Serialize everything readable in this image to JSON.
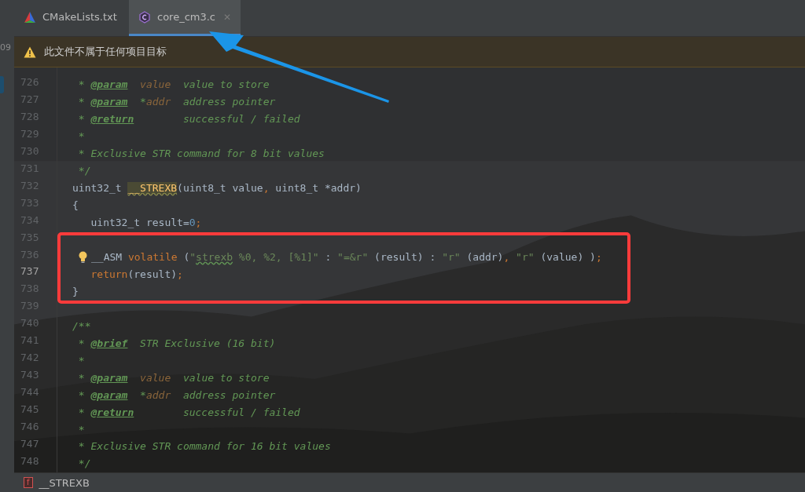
{
  "side_strip": {
    "text": "09"
  },
  "tabs": [
    {
      "label": "CMakeLists.txt",
      "kind": "cmake",
      "selected": false
    },
    {
      "label": "core_cm3.c",
      "kind": "c",
      "selected": true,
      "close": "✕"
    }
  ],
  "notice": {
    "text": "此文件不属于任何项目目标"
  },
  "lines": [
    {
      "number": "726",
      "current": false,
      "tokens": [
        {
          "kind": "comment",
          "text": " * "
        },
        {
          "kind": "tag",
          "text": "@param"
        },
        {
          "kind": "param",
          "text": "  value"
        },
        {
          "kind": "comment",
          "text": "  value to store"
        }
      ]
    },
    {
      "number": "727",
      "current": false,
      "tokens": [
        {
          "kind": "comment",
          "text": " * "
        },
        {
          "kind": "tag",
          "text": "@param"
        },
        {
          "kind": "comment",
          "text": "  *"
        },
        {
          "kind": "param",
          "text": "addr"
        },
        {
          "kind": "comment",
          "text": "  address pointer"
        }
      ]
    },
    {
      "number": "728",
      "current": false,
      "tokens": [
        {
          "kind": "comment",
          "text": " * "
        },
        {
          "kind": "tag",
          "text": "@return"
        },
        {
          "kind": "comment",
          "text": "        successful / failed"
        }
      ]
    },
    {
      "number": "729",
      "current": false,
      "tokens": [
        {
          "kind": "comment",
          "text": " *"
        }
      ]
    },
    {
      "number": "730",
      "current": false,
      "tokens": [
        {
          "kind": "comment",
          "text": " * Exclusive STR command for 8 bit values"
        }
      ]
    },
    {
      "number": "731",
      "current": false,
      "tokens": [
        {
          "kind": "comment",
          "text": " */"
        }
      ]
    },
    {
      "number": "732",
      "current": false,
      "tokens": [
        {
          "kind": "plain",
          "text": "uint32_t "
        },
        {
          "kind": "usage",
          "text": "__STREXB"
        },
        {
          "kind": "plain",
          "text": "(uint8_t value"
        },
        {
          "kind": "punct",
          "text": ","
        },
        {
          "kind": "plain",
          "text": " uint8_t *addr)"
        }
      ]
    },
    {
      "number": "733",
      "current": false,
      "tokens": [
        {
          "kind": "plain",
          "text": "{"
        }
      ]
    },
    {
      "number": "734",
      "current": false,
      "tokens": [
        {
          "kind": "plain",
          "text": "   uint32_t result="
        },
        {
          "kind": "number",
          "text": "0"
        },
        {
          "kind": "punct",
          "text": ";"
        }
      ]
    },
    {
      "number": "735",
      "current": false
    },
    {
      "number": "736",
      "current": false,
      "bulb": true,
      "tokens": [
        {
          "kind": "plain",
          "text": "__ASM "
        },
        {
          "kind": "keyword",
          "text": "volatile"
        },
        {
          "kind": "plain",
          "text": " ("
        },
        {
          "kind": "string",
          "text": "\""
        },
        {
          "kind": "typo",
          "text": "strexb"
        },
        {
          "kind": "string",
          "text": " %0, %2, [%1]\""
        },
        {
          "kind": "plain",
          "text": " : "
        },
        {
          "kind": "string",
          "text": "\"=&r\""
        },
        {
          "kind": "plain",
          "text": " (result) : "
        },
        {
          "kind": "string",
          "text": "\"r\""
        },
        {
          "kind": "plain",
          "text": " (addr)"
        },
        {
          "kind": "punct",
          "text": ","
        },
        {
          "kind": "string",
          "text": " \"r\""
        },
        {
          "kind": "plain",
          "text": " (value) )"
        },
        {
          "kind": "punct",
          "text": ";"
        }
      ]
    },
    {
      "number": "737",
      "current": true,
      "tokens": [
        {
          "kind": "keyword",
          "text": "   return"
        },
        {
          "kind": "plain",
          "text": "(result)"
        },
        {
          "kind": "punct",
          "text": ";"
        }
      ]
    },
    {
      "number": "738",
      "current": false,
      "tokens": [
        {
          "kind": "plain",
          "text": "}"
        }
      ]
    },
    {
      "number": "739",
      "current": false
    },
    {
      "number": "740",
      "current": false,
      "tokens": [
        {
          "kind": "comment",
          "text": "/**"
        }
      ]
    },
    {
      "number": "741",
      "current": false,
      "tokens": [
        {
          "kind": "comment",
          "text": " * "
        },
        {
          "kind": "tag",
          "text": "@brief"
        },
        {
          "kind": "comment",
          "text": "  STR Exclusive (16 bit)"
        }
      ]
    },
    {
      "number": "742",
      "current": false,
      "tokens": [
        {
          "kind": "comment",
          "text": " *"
        }
      ]
    },
    {
      "number": "743",
      "current": false,
      "tokens": [
        {
          "kind": "comment",
          "text": " * "
        },
        {
          "kind": "tag",
          "text": "@param"
        },
        {
          "kind": "param",
          "text": "  value"
        },
        {
          "kind": "comment",
          "text": "  value to store"
        }
      ]
    },
    {
      "number": "744",
      "current": false,
      "tokens": [
        {
          "kind": "comment",
          "text": " * "
        },
        {
          "kind": "tag",
          "text": "@param"
        },
        {
          "kind": "comment",
          "text": "  *"
        },
        {
          "kind": "param",
          "text": "addr"
        },
        {
          "kind": "comment",
          "text": "  address pointer"
        }
      ]
    },
    {
      "number": "745",
      "current": false,
      "tokens": [
        {
          "kind": "comment",
          "text": " * "
        },
        {
          "kind": "tag",
          "text": "@return"
        },
        {
          "kind": "comment",
          "text": "        successful / failed"
        }
      ]
    },
    {
      "number": "746",
      "current": false,
      "tokens": [
        {
          "kind": "comment",
          "text": " *"
        }
      ]
    },
    {
      "number": "747",
      "current": false,
      "tokens": [
        {
          "kind": "comment",
          "text": " * Exclusive STR command for 16 bit values"
        }
      ]
    },
    {
      "number": "748",
      "current": false,
      "tokens": [
        {
          "kind": "comment",
          "text": " */"
        }
      ]
    }
  ],
  "breadcrumb": {
    "badge": "f",
    "text": "__STREXB"
  }
}
